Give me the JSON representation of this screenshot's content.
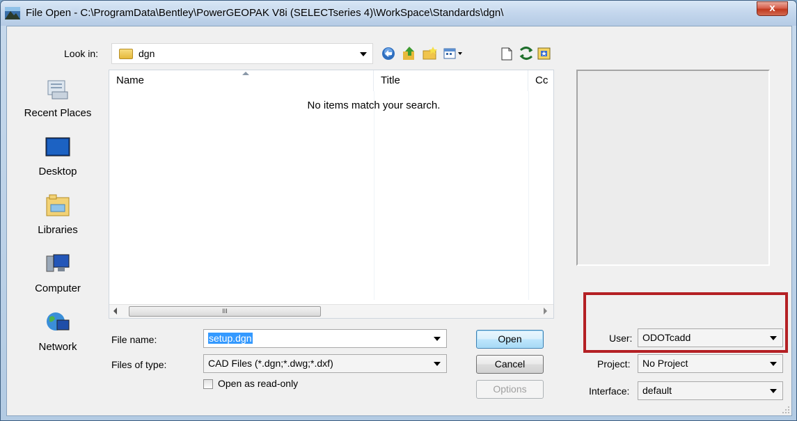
{
  "window": {
    "title": "File Open - C:\\ProgramData\\Bentley\\PowerGEOPAK V8i (SELECTseries 4)\\WorkSpace\\Standards\\dgn\\",
    "close_label": "x"
  },
  "lookin": {
    "label": "Look in:",
    "value": "dgn"
  },
  "toolbar": {
    "icons": [
      "back-icon",
      "up-folder-icon",
      "new-folder-icon",
      "view-menu-icon",
      "new-file-icon",
      "refresh-icon",
      "workspace-icon"
    ]
  },
  "places": [
    {
      "label": "Recent Places",
      "icon": "recent-places-icon"
    },
    {
      "label": "Desktop",
      "icon": "desktop-icon"
    },
    {
      "label": "Libraries",
      "icon": "libraries-icon"
    },
    {
      "label": "Computer",
      "icon": "computer-icon"
    },
    {
      "label": "Network",
      "icon": "network-icon"
    }
  ],
  "filelist": {
    "columns": [
      "Name",
      "Title",
      "Cc"
    ],
    "empty_message": "No items match your search.",
    "scroll_thumb_label": "III"
  },
  "form": {
    "file_name_label": "File name:",
    "file_name_value": "setup.dgn",
    "file_type_label": "Files of type:",
    "file_type_value": "CAD Files (*.dgn;*.dwg;*.dxf)",
    "readonly_label": "Open as read-only"
  },
  "buttons": {
    "open": "Open",
    "cancel": "Cancel",
    "options": "Options"
  },
  "workspace": {
    "user_label": "User:",
    "user_value": "ODOTcadd",
    "project_label": "Project:",
    "project_value": "No Project",
    "interface_label": "Interface:",
    "interface_value": "default"
  },
  "colors": {
    "highlight_box": "#b42024",
    "selection": "#3399ff"
  }
}
